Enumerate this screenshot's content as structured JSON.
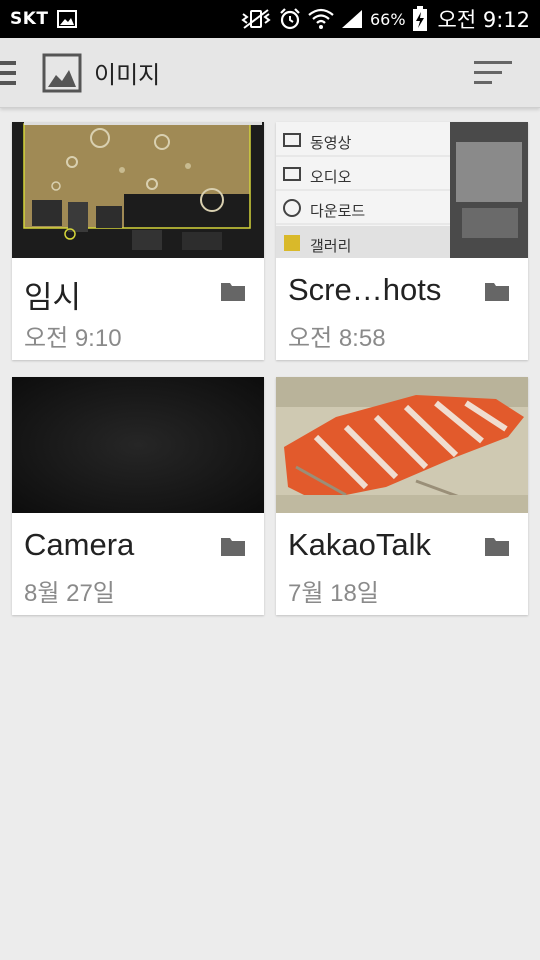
{
  "status_bar": {
    "carrier": "SKT",
    "battery_percent": "66%",
    "time": "오전 9:12",
    "icons": [
      "gallery-notification-icon",
      "vibrate-icon",
      "alarm-icon",
      "wifi-icon",
      "signal-icon",
      "battery-charging-icon"
    ]
  },
  "action_bar": {
    "title": "이미지",
    "icons": [
      "menu-icon",
      "image-icon",
      "sort-icon"
    ]
  },
  "albums": [
    {
      "name": "임시",
      "date": "오전 9:10",
      "icon": "folder-icon",
      "thumbnail": "game-screenshot"
    },
    {
      "name": "Scre…hots",
      "date": "오전 8:58",
      "icon": "folder-icon",
      "thumbnail": "menu-screenshot",
      "thumb_menu": [
        "동영상",
        "오디오",
        "다운로드",
        "갤러리"
      ]
    },
    {
      "name": "Camera",
      "date": "8월 27일",
      "icon": "folder-icon",
      "thumbnail": "dark-photo"
    },
    {
      "name": "KakaoTalk",
      "date": "7월 18일",
      "icon": "folder-icon",
      "thumbnail": "salmon-photo"
    }
  ],
  "colors": {
    "status_bar_bg": "#000000",
    "action_bar_bg": "#e6e6e6",
    "page_bg": "#ececec",
    "card_bg": "#ffffff",
    "folder_icon": "#666666"
  }
}
